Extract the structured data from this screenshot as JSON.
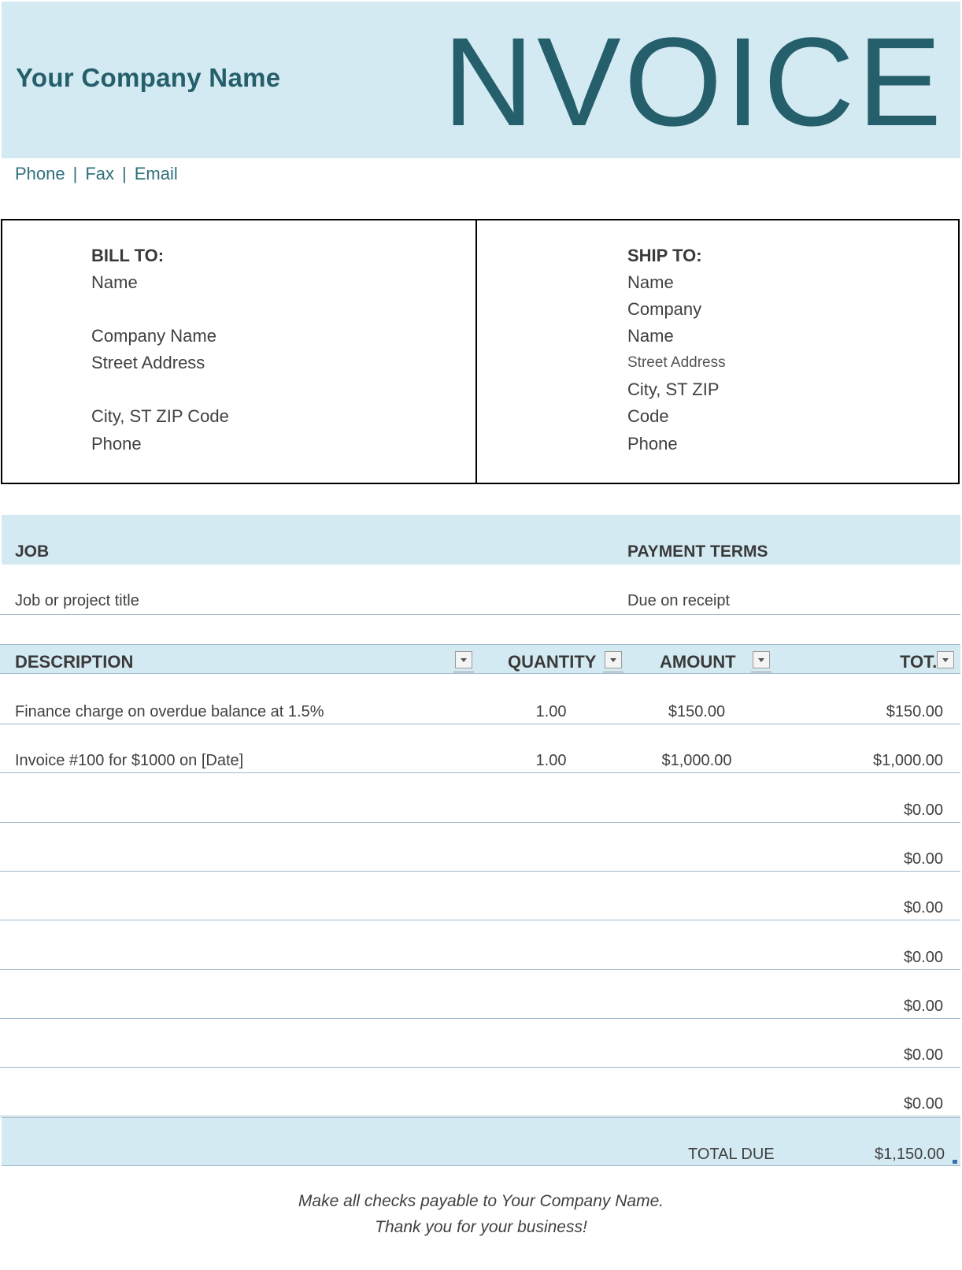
{
  "header": {
    "company_name": "Your Company Name",
    "title": "NVOICE",
    "contact": {
      "phone": "Phone",
      "fax": "Fax",
      "email": "Email",
      "separator": "|"
    }
  },
  "bill_to": {
    "heading": "BILL TO:",
    "lines": [
      "Name",
      "Company Name",
      "Street Address",
      "City, ST ZIP Code",
      "Phone"
    ]
  },
  "ship_to": {
    "heading": "SHIP TO:",
    "lines": [
      "Name",
      "Company",
      "Name",
      "Street Address",
      "City, ST ZIP",
      "Code",
      "Phone"
    ]
  },
  "job": {
    "heading": "JOB",
    "value": "Job or project title"
  },
  "payment_terms": {
    "heading": "PAYMENT TERMS",
    "value": "Due on receipt"
  },
  "table": {
    "columns": [
      "DESCRIPTION",
      "QUANTITY",
      "AMOUNT",
      "TOT."
    ],
    "rows": [
      {
        "description": "Finance charge on overdue balance at 1.5%",
        "quantity": "1.00",
        "amount": "$150.00",
        "total": "$150.00"
      },
      {
        "description": "Invoice #100 for $1000 on [Date]",
        "quantity": "1.00",
        "amount": "$1,000.00",
        "total": "$1,000.00"
      },
      {
        "description": "",
        "quantity": "",
        "amount": "",
        "total": "$0.00"
      },
      {
        "description": "",
        "quantity": "",
        "amount": "",
        "total": "$0.00"
      },
      {
        "description": "",
        "quantity": "",
        "amount": "",
        "total": "$0.00"
      },
      {
        "description": "",
        "quantity": "",
        "amount": "",
        "total": "$0.00"
      },
      {
        "description": "",
        "quantity": "",
        "amount": "",
        "total": "$0.00"
      },
      {
        "description": "",
        "quantity": "",
        "amount": "",
        "total": "$0.00"
      },
      {
        "description": "",
        "quantity": "",
        "amount": "",
        "total": "$0.00"
      }
    ]
  },
  "total": {
    "label": "TOTAL DUE",
    "value": "$1,150.00"
  },
  "footer": {
    "line1": "Make all checks payable to Your Company Name.",
    "line2": "Thank you for your business!"
  },
  "colors": {
    "band": "#d4eaf2",
    "accent": "#245f6b",
    "rule": "#9fb8cf"
  }
}
